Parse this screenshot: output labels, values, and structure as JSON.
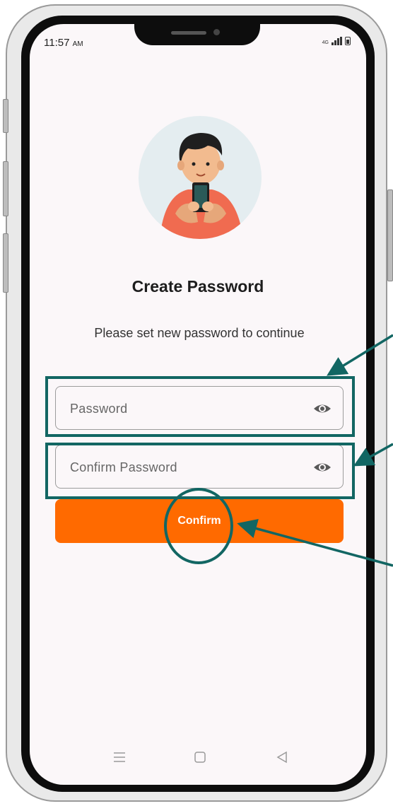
{
  "status_bar": {
    "time": "11:57",
    "time_suffix": "AM",
    "network_label": "4G"
  },
  "page": {
    "title": "Create Password",
    "subtitle": "Please set new password to continue"
  },
  "form": {
    "password_placeholder": "Password",
    "confirm_password_placeholder": "Confirm Password",
    "confirm_button_label": "Confirm"
  },
  "colors": {
    "primary_button": "#ff6a00",
    "annotation": "#126663",
    "screen_background": "#fbf7f9"
  },
  "icons": [
    "eye-icon",
    "menu-icon",
    "home-square-icon",
    "back-triangle-icon"
  ]
}
